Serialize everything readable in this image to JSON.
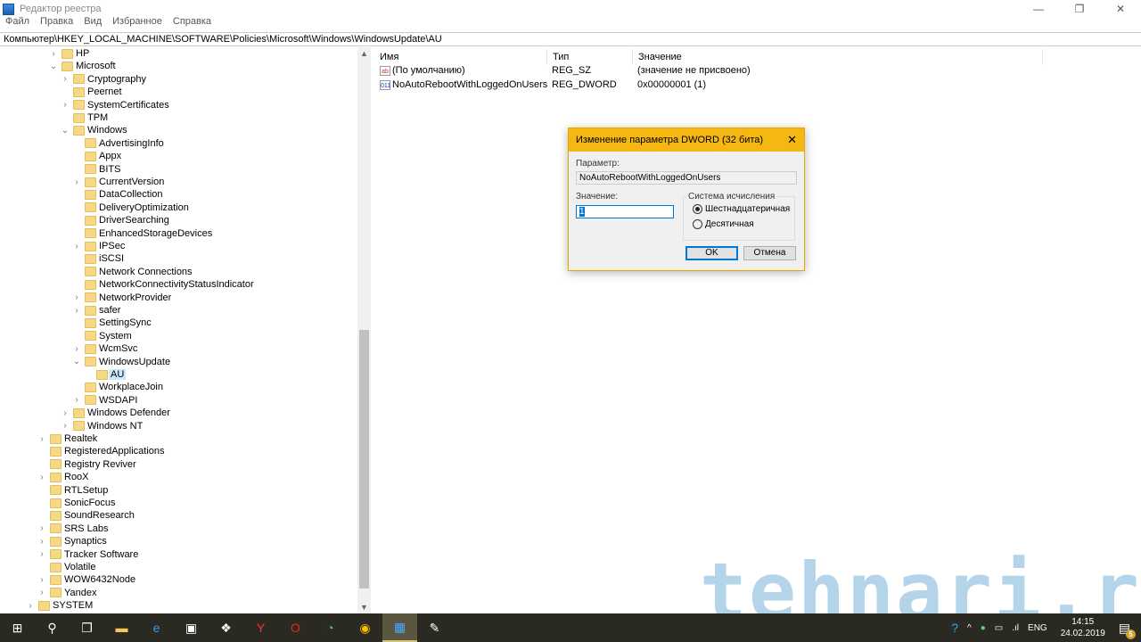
{
  "window": {
    "title": "Редактор реестра",
    "minimize": "—",
    "maximize": "❐",
    "close": "✕"
  },
  "menu": [
    "Файл",
    "Правка",
    "Вид",
    "Избранное",
    "Справка"
  ],
  "address": "Компьютер\\HKEY_LOCAL_MACHINE\\SOFTWARE\\Policies\\Microsoft\\Windows\\WindowsUpdate\\AU",
  "tree": [
    {
      "label": "HP",
      "level": 0,
      "arrow": ">"
    },
    {
      "label": "Microsoft",
      "level": 0,
      "arrow": "v"
    },
    {
      "label": "Cryptography",
      "level": 1,
      "arrow": ">"
    },
    {
      "label": "Peernet",
      "level": 1,
      "arrow": ""
    },
    {
      "label": "SystemCertificates",
      "level": 1,
      "arrow": ">"
    },
    {
      "label": "TPM",
      "level": 1,
      "arrow": ""
    },
    {
      "label": "Windows",
      "level": 1,
      "arrow": "v"
    },
    {
      "label": "AdvertisingInfo",
      "level": 2,
      "arrow": ""
    },
    {
      "label": "Appx",
      "level": 2,
      "arrow": ""
    },
    {
      "label": "BITS",
      "level": 2,
      "arrow": ""
    },
    {
      "label": "CurrentVersion",
      "level": 2,
      "arrow": ">"
    },
    {
      "label": "DataCollection",
      "level": 2,
      "arrow": ""
    },
    {
      "label": "DeliveryOptimization",
      "level": 2,
      "arrow": ""
    },
    {
      "label": "DriverSearching",
      "level": 2,
      "arrow": ""
    },
    {
      "label": "EnhancedStorageDevices",
      "level": 2,
      "arrow": ""
    },
    {
      "label": "IPSec",
      "level": 2,
      "arrow": ">"
    },
    {
      "label": "iSCSI",
      "level": 2,
      "arrow": ""
    },
    {
      "label": "Network Connections",
      "level": 2,
      "arrow": ""
    },
    {
      "label": "NetworkConnectivityStatusIndicator",
      "level": 2,
      "arrow": ""
    },
    {
      "label": "NetworkProvider",
      "level": 2,
      "arrow": ">"
    },
    {
      "label": "safer",
      "level": 2,
      "arrow": ">"
    },
    {
      "label": "SettingSync",
      "level": 2,
      "arrow": ""
    },
    {
      "label": "System",
      "level": 2,
      "arrow": ""
    },
    {
      "label": "WcmSvc",
      "level": 2,
      "arrow": ">"
    },
    {
      "label": "WindowsUpdate",
      "level": 2,
      "arrow": "v"
    },
    {
      "label": "AU",
      "level": 3,
      "arrow": "",
      "selected": true
    },
    {
      "label": "WorkplaceJoin",
      "level": 2,
      "arrow": ""
    },
    {
      "label": "WSDAPI",
      "level": 2,
      "arrow": ">"
    },
    {
      "label": "Windows Defender",
      "level": 1,
      "arrow": ">"
    },
    {
      "label": "Windows NT",
      "level": 1,
      "arrow": ">"
    },
    {
      "label": "Realtek",
      "level": -1,
      "arrow": ">"
    },
    {
      "label": "RegisteredApplications",
      "level": -1,
      "arrow": ""
    },
    {
      "label": "Registry Reviver",
      "level": -1,
      "arrow": ""
    },
    {
      "label": "RooX",
      "level": -1,
      "arrow": ">"
    },
    {
      "label": "RTLSetup",
      "level": -1,
      "arrow": ""
    },
    {
      "label": "SonicFocus",
      "level": -1,
      "arrow": ""
    },
    {
      "label": "SoundResearch",
      "level": -1,
      "arrow": ""
    },
    {
      "label": "SRS Labs",
      "level": -1,
      "arrow": ">"
    },
    {
      "label": "Synaptics",
      "level": -1,
      "arrow": ">"
    },
    {
      "label": "Tracker Software",
      "level": -1,
      "arrow": ">"
    },
    {
      "label": "Volatile",
      "level": -1,
      "arrow": ""
    },
    {
      "label": "WOW6432Node",
      "level": -1,
      "arrow": ">"
    },
    {
      "label": "Yandex",
      "level": -1,
      "arrow": ">"
    },
    {
      "label": "SYSTEM",
      "level": -2,
      "arrow": ">"
    }
  ],
  "list": {
    "headers": [
      "Имя",
      "Тип",
      "Значение"
    ],
    "rows": [
      {
        "icon": "ab",
        "name": "(По умолчанию)",
        "type": "REG_SZ",
        "value": "(значение не присвоено)"
      },
      {
        "icon": "011",
        "name": "NoAutoRebootWithLoggedOnUsers",
        "type": "REG_DWORD",
        "value": "0x00000001 (1)"
      }
    ]
  },
  "dialog": {
    "title": "Изменение параметра DWORD (32 бита)",
    "param_label": "Параметр:",
    "param_value": "NoAutoRebootWithLoggedOnUsers",
    "value_label": "Значение:",
    "value": "1",
    "base_group": "Система исчисления",
    "hex": "Шестнадцатеричная",
    "dec": "Десятичная",
    "ok": "OK",
    "cancel": "Отмена",
    "close": "✕"
  },
  "watermark": "tehnari.ru",
  "taskbar": {
    "lang": "ENG",
    "time": "14:15",
    "date": "24.02.2019",
    "notifications": "5"
  }
}
